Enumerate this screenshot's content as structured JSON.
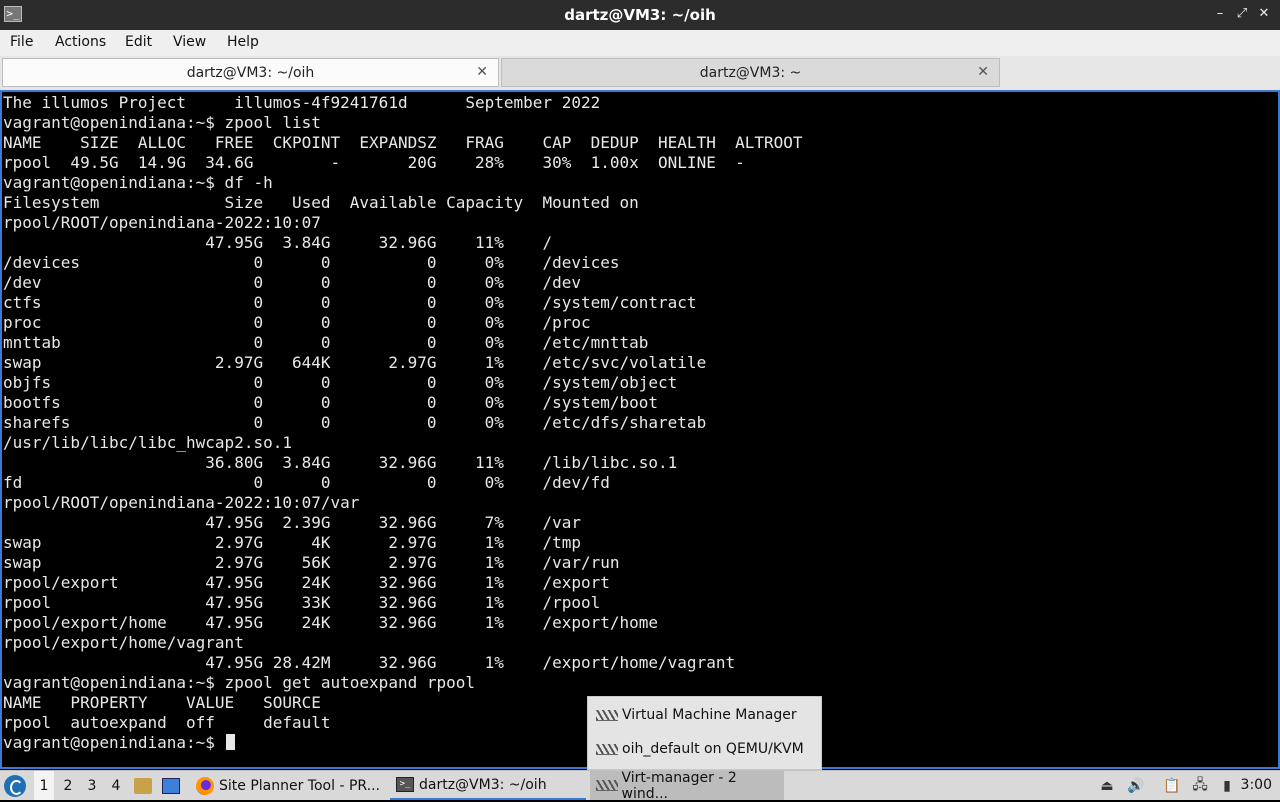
{
  "window": {
    "title": "dartz@VM3: ~/oih",
    "icon_name": "terminal-app-icon",
    "controls": {
      "minimize": "–",
      "restore": "⤢",
      "close": "✕"
    }
  },
  "menu": {
    "file": "File",
    "actions": "Actions",
    "edit": "Edit",
    "view": "View",
    "help": "Help"
  },
  "tabs": [
    {
      "label": "dartz@VM3: ~/oih",
      "close": "✕",
      "active": true
    },
    {
      "label": "dartz@VM3: ~",
      "close": "✕",
      "active": false
    }
  ],
  "terminal": {
    "lines": [
      "The illumos Project     illumos-4f9241761d      September 2022",
      "vagrant@openindiana:~$ zpool list",
      "NAME    SIZE  ALLOC   FREE  CKPOINT  EXPANDSZ   FRAG    CAP  DEDUP  HEALTH  ALTROOT",
      "rpool  49.5G  14.9G  34.6G        -       20G    28%    30%  1.00x  ONLINE  -",
      "vagrant@openindiana:~$ df -h",
      "Filesystem             Size   Used  Available Capacity  Mounted on",
      "rpool/ROOT/openindiana-2022:10:07",
      "                     47.95G  3.84G     32.96G    11%    /",
      "/devices                  0      0          0     0%    /devices",
      "/dev                      0      0          0     0%    /dev",
      "ctfs                      0      0          0     0%    /system/contract",
      "proc                      0      0          0     0%    /proc",
      "mnttab                    0      0          0     0%    /etc/mnttab",
      "swap                  2.97G   644K      2.97G     1%    /etc/svc/volatile",
      "objfs                     0      0          0     0%    /system/object",
      "bootfs                    0      0          0     0%    /system/boot",
      "sharefs                   0      0          0     0%    /etc/dfs/sharetab",
      "/usr/lib/libc/libc_hwcap2.so.1",
      "                     36.80G  3.84G     32.96G    11%    /lib/libc.so.1",
      "fd                        0      0          0     0%    /dev/fd",
      "rpool/ROOT/openindiana-2022:10:07/var",
      "                     47.95G  2.39G     32.96G     7%    /var",
      "swap                  2.97G     4K      2.97G     1%    /tmp",
      "swap                  2.97G    56K      2.97G     1%    /var/run",
      "rpool/export         47.95G    24K     32.96G     1%    /export",
      "rpool                47.95G    33K     32.96G     1%    /rpool",
      "rpool/export/home    47.95G    24K     32.96G     1%    /export/home",
      "rpool/export/home/vagrant",
      "                     47.95G 28.42M     32.96G     1%    /export/home/vagrant",
      "vagrant@openindiana:~$ zpool get autoexpand rpool",
      "NAME   PROPERTY    VALUE   SOURCE",
      "rpool  autoexpand  off     default"
    ],
    "prompt": "vagrant@openindiana:~$ "
  },
  "popup": {
    "items": [
      {
        "label": "Virtual Machine Manager",
        "icon": "virt-manager-icon"
      },
      {
        "label": "oih_default on QEMU/KVM",
        "icon": "virt-manager-icon"
      }
    ]
  },
  "taskbar": {
    "workspaces": [
      "1",
      "2",
      "3",
      "4"
    ],
    "tasks": [
      {
        "label": "Site Planner Tool - PR...",
        "icon": "firefox-icon"
      },
      {
        "label": "dartz@VM3: ~/oih",
        "icon": "terminal-icon"
      },
      {
        "label": "Virt-manager - 2 wind...",
        "icon": "virt-manager-icon"
      }
    ],
    "clock": "3:00"
  },
  "colors": {
    "accent": "#3a7bd5",
    "terminal_bg": "#000000",
    "terminal_fg": "#e8e8e8"
  }
}
